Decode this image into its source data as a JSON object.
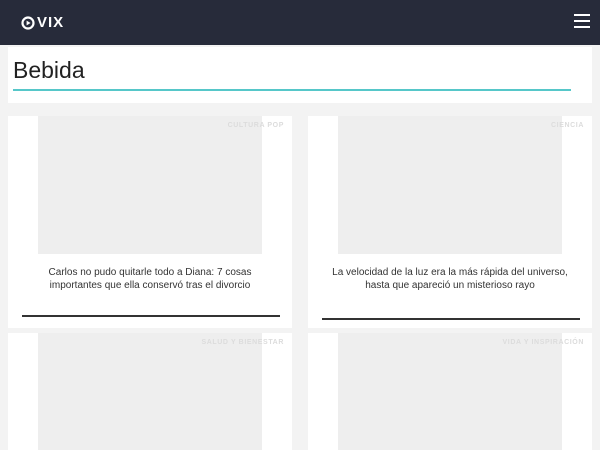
{
  "header": {
    "logo_text": "VIX",
    "menu_icon": "hamburger-menu-icon",
    "background": "#272b3a"
  },
  "page": {
    "title": "Bebida",
    "accent_color": "#56c7c9"
  },
  "cards": [
    {
      "category": "CULTURA POP",
      "headline": "Carlos no pudo quitarle todo a Diana: 7 cosas importantes que ella conservó tras el divorcio"
    },
    {
      "category": "CIENCIA",
      "headline": "La velocidad de la luz era la más rápida del universo, hasta que apareció un misterioso rayo"
    },
    {
      "category": "SALUD Y BIENESTAR",
      "headline": ""
    },
    {
      "category": "VIDA Y INSPIRACIÓN",
      "headline": ""
    }
  ]
}
